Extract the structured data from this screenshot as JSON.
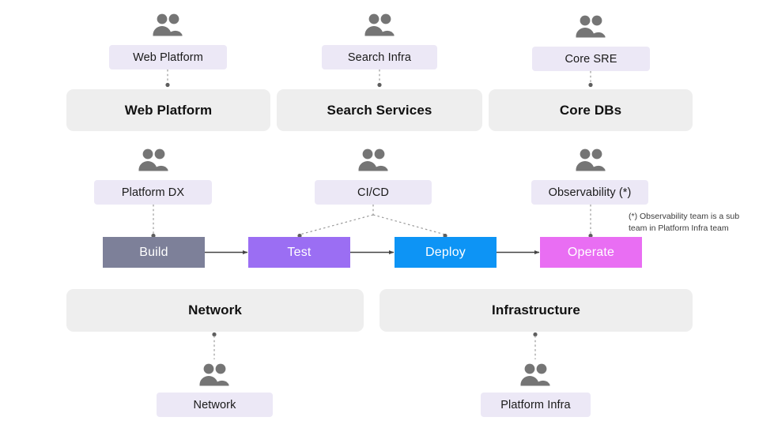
{
  "colors": {
    "background": "#ffffff",
    "tag_bg": "#ece8f6",
    "domain_bg": "#eeeeee",
    "icon_gray": "#757575",
    "connector_gray": "#8a8a8a",
    "arrow_gray": "#444444",
    "build": "#7d8099",
    "test": "#9b6ef3",
    "deploy": "#0d94f5",
    "operate": "#e96ef3"
  },
  "top_row": {
    "teams": [
      {
        "label": "Web Platform",
        "icon": "people-icon"
      },
      {
        "label": "Search Infra",
        "icon": "people-icon"
      },
      {
        "label": "Core SRE",
        "icon": "people-icon"
      }
    ],
    "domains": [
      {
        "label": "Web Platform"
      },
      {
        "label": "Search Services"
      },
      {
        "label": "Core DBs"
      }
    ]
  },
  "pipeline_row": {
    "teams": [
      {
        "label": "Platform DX",
        "icon": "people-icon"
      },
      {
        "label": "CI/CD",
        "icon": "people-icon"
      },
      {
        "label": "Observability (*)",
        "icon": "people-icon"
      }
    ],
    "stages": [
      {
        "label": "Build",
        "color": "#7d8099"
      },
      {
        "label": "Test",
        "color": "#9b6ef3"
      },
      {
        "label": "Deploy",
        "color": "#0d94f5"
      },
      {
        "label": "Operate",
        "color": "#e96ef3"
      }
    ],
    "footnote": "(*) Observability team is a sub team in Platform Infra team"
  },
  "bottom_row": {
    "domains": [
      {
        "label": "Network"
      },
      {
        "label": "Infrastructure"
      }
    ],
    "teams": [
      {
        "label": "Network",
        "icon": "people-icon"
      },
      {
        "label": "Platform Infra",
        "icon": "people-icon"
      }
    ]
  }
}
